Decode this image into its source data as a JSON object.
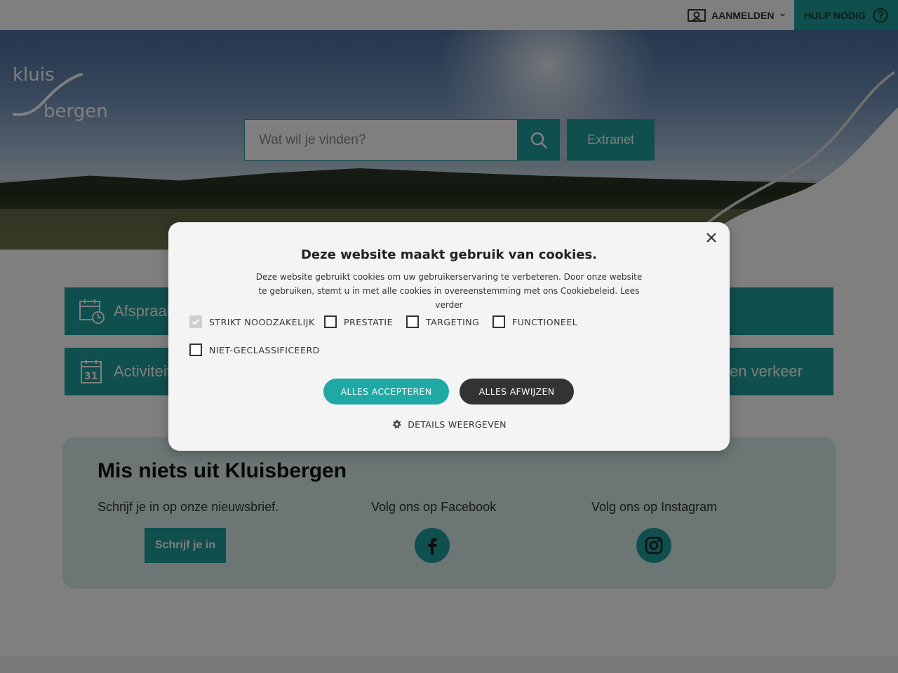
{
  "topbar": {
    "login_label": "AANMELDEN",
    "help_label": "HULP NODIG"
  },
  "hero": {
    "logo_text": [
      "kluis",
      "bergen"
    ],
    "search_placeholder": "Wat wil je vinden?",
    "extranet_label": "Extranet"
  },
  "tiles": [
    {
      "label": "Afspraak"
    },
    {
      "label": "Activiteiten"
    },
    {
      "label": "en verkeer"
    }
  ],
  "newsletter": {
    "title": "Mis niets uit Kluisbergen",
    "subscribe_text": "Schrijf je in op onze nieuwsbrief.",
    "subscribe_button": "Schrijf je in",
    "facebook_text": "Volg ons op Facebook",
    "instagram_text": "Volg ons op Instagram"
  },
  "cookie_modal": {
    "title": "Deze website maakt gebruik van cookies.",
    "description": "Deze website gebruikt cookies om uw gebruikerservaring te verbeteren. Door onze website te gebruiken, stemt u in met alle cookies in overeenstemming met ons Cookiebeleid. Lees verder",
    "categories": [
      {
        "label": "STRIKT NOODZAKELIJK",
        "checked": true
      },
      {
        "label": "PRESTATIE",
        "checked": false
      },
      {
        "label": "TARGETING",
        "checked": false
      },
      {
        "label": "FUNCTIONEEL",
        "checked": false
      },
      {
        "label": "NIET-GECLASSIFICEERD",
        "checked": false
      }
    ],
    "accept_label": "ALLES ACCEPTEREN",
    "reject_label": "ALLES AFWIJZEN",
    "details_label": "DETAILS WEERGEVEN"
  },
  "colors": {
    "accent": "#1f9e9a",
    "dark_button": "#333333"
  }
}
